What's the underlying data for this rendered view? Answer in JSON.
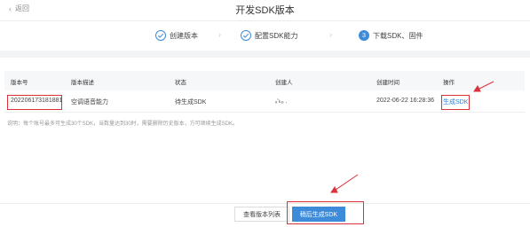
{
  "header": {
    "back_label": "返回",
    "title": "开发SDK版本"
  },
  "steps": [
    {
      "label": "创建版本",
      "status": "done"
    },
    {
      "label": "配置SDK能力",
      "status": "done"
    },
    {
      "label": "下载SDK、固件",
      "status": "active",
      "number": "3"
    }
  ],
  "table": {
    "columns": [
      "版本号",
      "版本描述",
      "状态",
      "创建人",
      "创建时间",
      "操作"
    ],
    "rows": [
      {
        "version": "202206173181881",
        "description": "空调语音能力",
        "status": "待生成SDK",
        "creator": "ₓ‘ₖₒ .",
        "created_at": "2022-06-22 16:28:36",
        "action": "生成SDK"
      }
    ]
  },
  "note": "说明：每个账号最多可生成30个SDK，当数量达到30时，需要删除历史版本，方可继续生成SDK。",
  "footer": {
    "secondary_label": "查看版本列表",
    "primary_label": "稍后生成SDK"
  },
  "colors": {
    "accent": "#3d8bd9",
    "annotation": "#d9323a"
  }
}
